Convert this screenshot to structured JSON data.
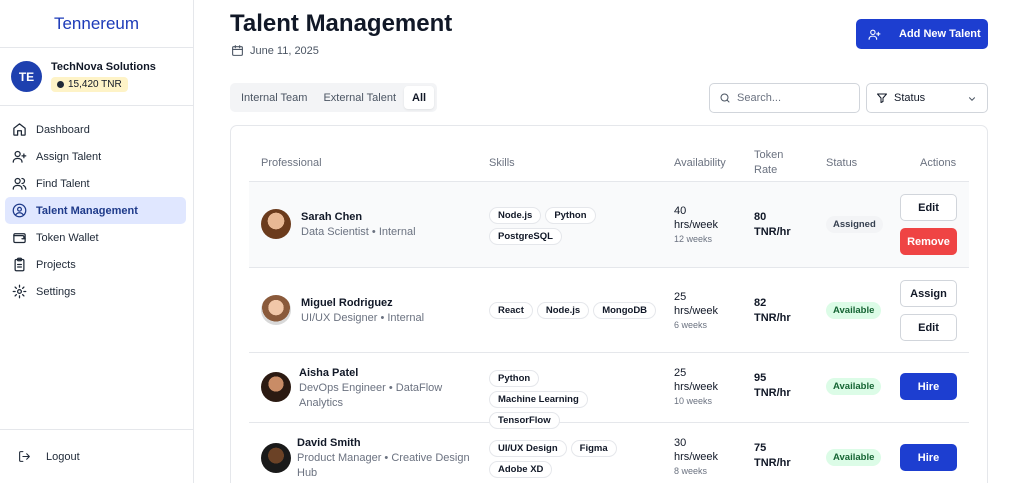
{
  "sidebar": {
    "brand": "Tennereum",
    "org": {
      "initials": "TE",
      "name": "TechNova Solutions",
      "balance": "15,420 TNR"
    },
    "items": [
      {
        "label": "Dashboard",
        "icon": "home-icon"
      },
      {
        "label": "Assign Talent",
        "icon": "user-plus-icon"
      },
      {
        "label": "Find Talent",
        "icon": "users-icon"
      },
      {
        "label": "Talent Management",
        "icon": "user-circle-icon",
        "active": true
      },
      {
        "label": "Token Wallet",
        "icon": "wallet-icon"
      },
      {
        "label": "Projects",
        "icon": "clipboard-icon"
      },
      {
        "label": "Settings",
        "icon": "gear-icon"
      }
    ],
    "logout": "Logout"
  },
  "header": {
    "title": "Talent Management",
    "date": "June 11, 2025",
    "add_button": "Add New Talent"
  },
  "filters": {
    "tabs": [
      {
        "label": "Internal Team"
      },
      {
        "label": "External Talent"
      },
      {
        "label": "All",
        "active": true
      }
    ],
    "search_placeholder": "Search...",
    "status_label": "Status"
  },
  "table": {
    "columns": {
      "professional": "Professional",
      "skills": "Skills",
      "availability": "Availability",
      "rate_line1": "Token",
      "rate_line2": "Rate",
      "status": "Status",
      "actions": "Actions"
    },
    "rows": [
      {
        "name": "Sarah Chen",
        "role": "Data Scientist • Internal",
        "skills": [
          "Node.js",
          "Python",
          "PostgreSQL"
        ],
        "hours": "40",
        "hours_unit": "hrs/week",
        "duration": "12 weeks",
        "rate": "80",
        "rate_unit": "TNR/hr",
        "status": "Assigned",
        "actions": [
          "Edit",
          "Remove"
        ]
      },
      {
        "name": "Miguel Rodriguez",
        "role": "UI/UX Designer • Internal",
        "skills": [
          "React",
          "Node.js",
          "MongoDB"
        ],
        "hours": "25",
        "hours_unit": "hrs/week",
        "duration": "6 weeks",
        "rate": "82",
        "rate_unit": "TNR/hr",
        "status": "Available",
        "actions": [
          "Assign",
          "Edit"
        ]
      },
      {
        "name": "Aisha Patel",
        "role_line1": "DevOps Engineer • DataFlow",
        "role_line2": "Analytics",
        "skills": [
          "Python",
          "Machine Learning",
          "TensorFlow"
        ],
        "hours": "25",
        "hours_unit": "hrs/week",
        "duration": "10 weeks",
        "rate": "95",
        "rate_unit": "TNR/hr",
        "status": "Available",
        "actions": [
          "Hire"
        ]
      },
      {
        "name": "David Smith",
        "role_line1": "Product Manager • Creative Design",
        "role_line2": "Hub",
        "skills": [
          "UI/UX Design",
          "Figma",
          "Adobe XD"
        ],
        "hours": "30",
        "hours_unit": "hrs/week",
        "duration": "8 weeks",
        "rate": "75",
        "rate_unit": "TNR/hr",
        "status": "Available",
        "actions": [
          "Hire"
        ]
      }
    ]
  }
}
